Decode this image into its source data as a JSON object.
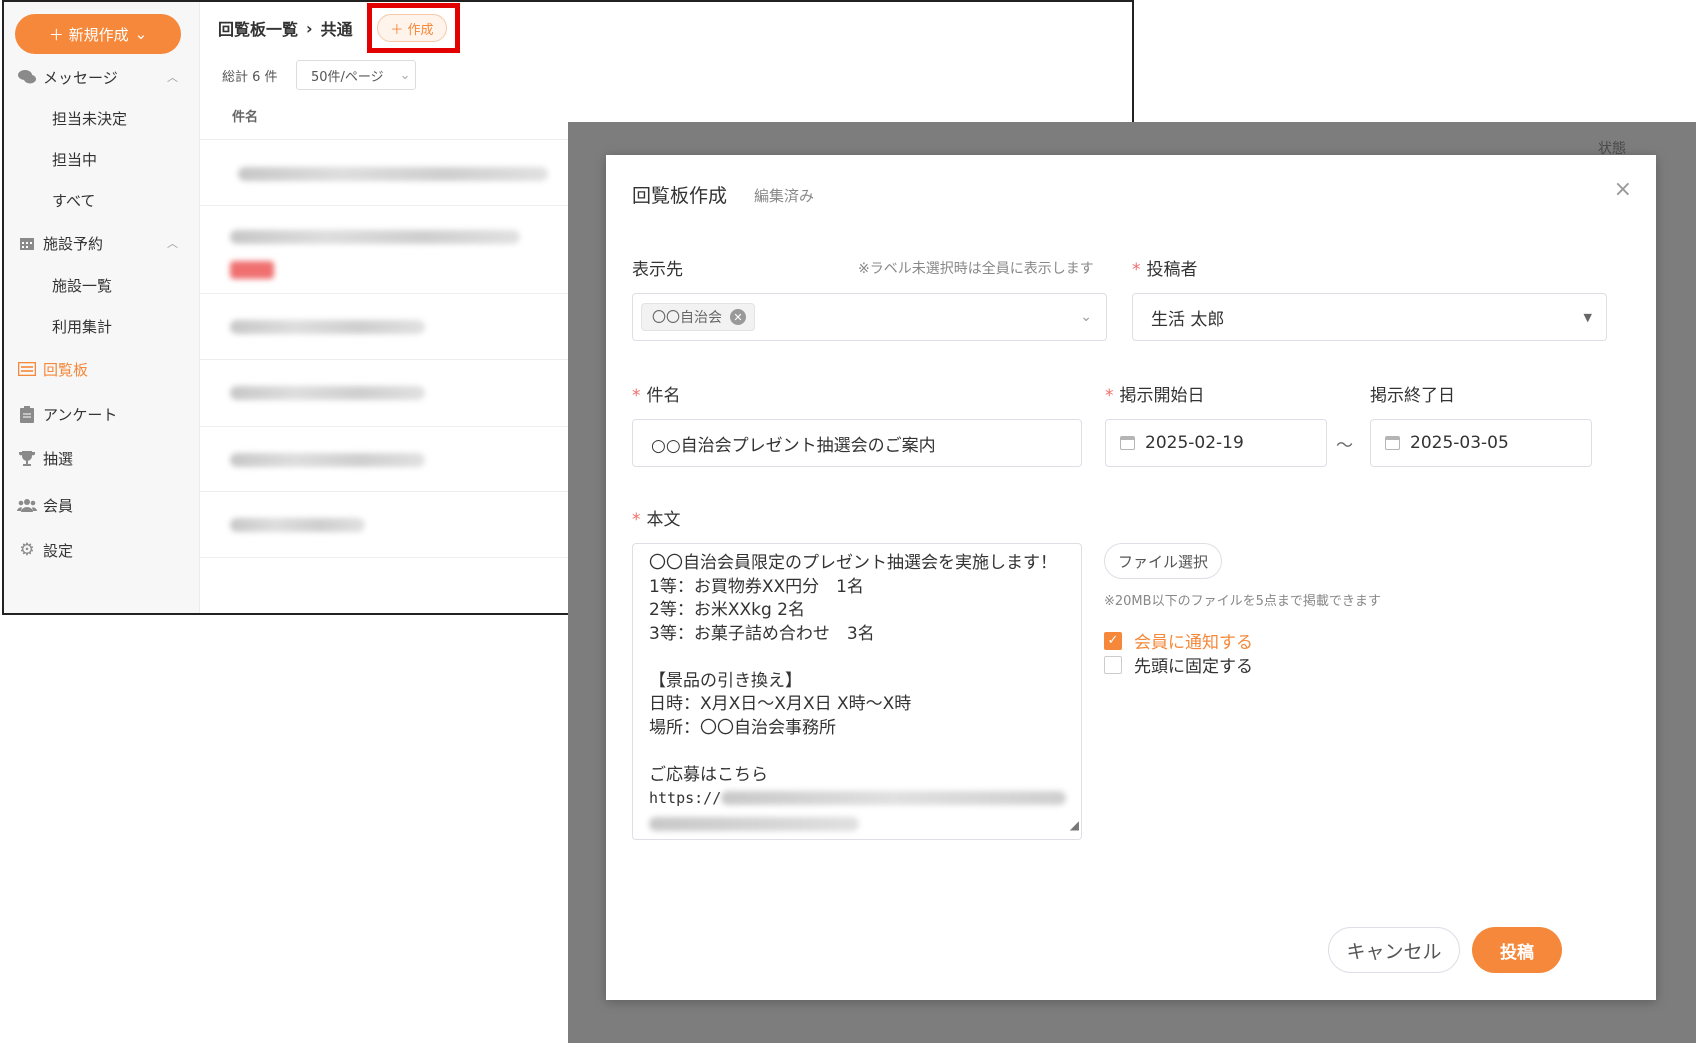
{
  "sidebar": {
    "new_button": "＋ 新規作成",
    "messages": "メッセージ",
    "messages_sub": [
      "担当未決定",
      "担当中",
      "すべて"
    ],
    "facility": "施設予約",
    "facility_sub": [
      "施設一覧",
      "利用集計"
    ],
    "circular": "回覧板",
    "survey": "アンケート",
    "lottery": "抽選",
    "members": "会員",
    "settings": "設定"
  },
  "list": {
    "breadcrumb_root": "回覧板一覧",
    "breadcrumb_sep": "›",
    "breadcrumb_current": "共通",
    "create_button": "＋ 作成",
    "total": "総計 6 件",
    "per_page": "50件/ページ",
    "column_subject": "件名",
    "column_status": "状態"
  },
  "modal": {
    "title": "回覧板作成",
    "edited": "編集済み",
    "close": "×",
    "display_to_label": "表示先",
    "display_to_hint": "※ラベル未選択時は全員に表示します",
    "display_tag": "〇〇自治会",
    "poster_label": "投稿者",
    "poster_value": "生活 太郎",
    "subject_label": "件名",
    "subject_value": "○○自治会プレゼント抽選会のご案内",
    "start_label": "掲示開始日",
    "start_value": "2025-02-19",
    "range_sep": "〜",
    "end_label": "掲示終了日",
    "end_value": "2025-03-05",
    "body_label": "本文",
    "body_lines": [
      "〇〇自治会員限定のプレゼント抽選会を実施します！",
      "1等：お買物券XX円分　1名",
      "2等：お米XXkg 2名",
      "3等：お菓子詰め合わせ　3名",
      "",
      "【景品の引き換え】",
      "日時：X月X日～X月X日 X時～X時",
      "場所：〇〇自治会事務所",
      "",
      "ご応募はこちら",
      "https://"
    ],
    "file_button": "ファイル選択",
    "file_hint": "※20MB以下のファイルを5点まで掲載できます",
    "notify_label": "会員に通知する",
    "pin_label": "先頭に固定する",
    "cancel_button": "キャンセル",
    "submit_button": "投稿",
    "accent_color": "#f5883a"
  }
}
